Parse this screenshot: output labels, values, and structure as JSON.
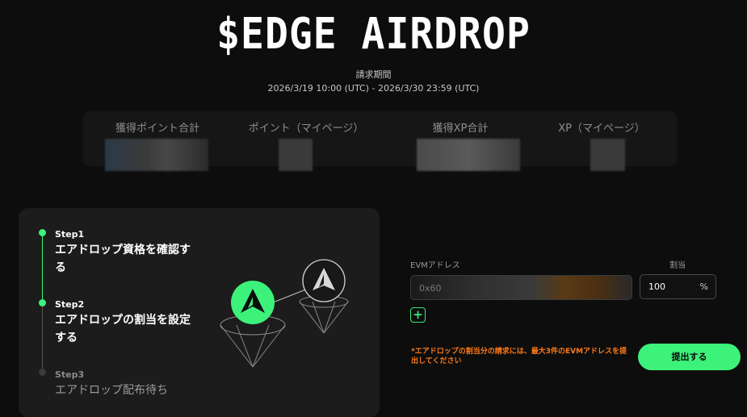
{
  "header": {
    "title": "$EDGE AIRDROP",
    "period_label": "請求期間",
    "period_value": "2026/3/19 10:00 (UTC) - 2026/3/30 23:59 (UTC)"
  },
  "stats": {
    "points_total_label": "獲得ポイント合計",
    "points_mypage_label": "ポイント（マイページ）",
    "xp_total_label": "獲得XP合計",
    "xp_mypage_label": "XP（マイページ）"
  },
  "steps": [
    {
      "label": "Step1",
      "text": "エアドロップ資格を確認する",
      "state": "done"
    },
    {
      "label": "Step2",
      "text": "エアドロップの割当を設定する",
      "state": "active"
    },
    {
      "label": "Step3",
      "text": "エアドロップ配布待ち",
      "state": "pending"
    }
  ],
  "form": {
    "evm_label": "EVMアドレス",
    "evm_value": "0x60",
    "allocation_label": "割当",
    "allocation_value": "100",
    "percent_sign": "%",
    "add_button": "+",
    "note": "*エアドロップの割当分の請求には、最大3件のEVMアドレスを提出してください",
    "submit_label": "提出する"
  },
  "colors": {
    "accent": "#3df27a",
    "warning": "#ff7a1a",
    "background": "#0d0d0d",
    "card": "#1c1c1c"
  }
}
